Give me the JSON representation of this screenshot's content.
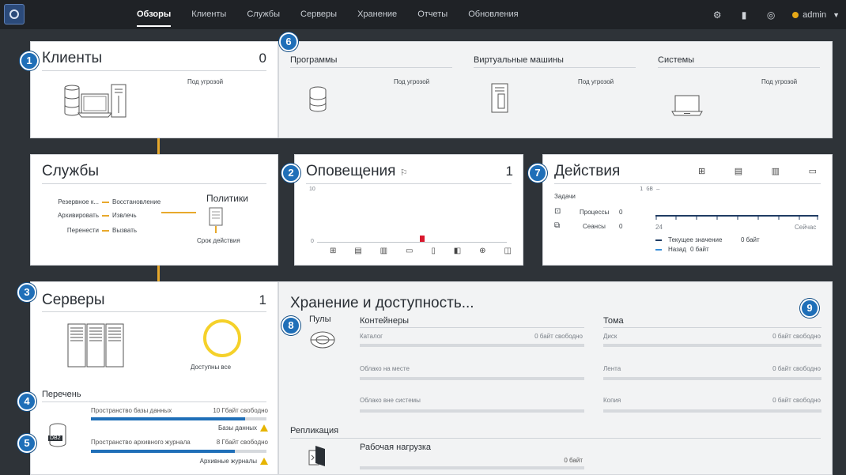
{
  "nav": {
    "tabs": [
      "Обзоры",
      "Клиенты",
      "Службы",
      "Серверы",
      "Хранение",
      "Отчеты",
      "Обновления"
    ],
    "active_tab": "Обзоры",
    "user": "admin"
  },
  "badges": [
    "1",
    "2",
    "3",
    "4",
    "5",
    "6",
    "7",
    "8",
    "9"
  ],
  "clients": {
    "title": "Клиенты",
    "count": "0",
    "status": "Под угрозой"
  },
  "programs": {
    "columns": [
      {
        "title": "Программы",
        "status": "Под угрозой"
      },
      {
        "title": "Виртуальные машины",
        "status": "Под угрозой"
      },
      {
        "title": "Системы",
        "status": "Под угрозой"
      }
    ]
  },
  "services": {
    "title": "Службы",
    "pairs": [
      {
        "left": "Резервное к...",
        "right": "Восстановление"
      },
      {
        "left": "Архивировать",
        "right": "Извлечь"
      },
      {
        "left": "Перенести",
        "right": "Вызвать"
      }
    ],
    "policies_title": "Политики",
    "policies_label": "Срок действия"
  },
  "alerts": {
    "title": "Оповещения",
    "count": "1",
    "y_top": "10",
    "y_bottom": "0"
  },
  "actions": {
    "title": "Действия",
    "tasks_label": "Задачи",
    "processes_label": "Процессы",
    "processes_value": "0",
    "sessions_label": "Сеансы",
    "sessions_value": "0",
    "axis_top": "1 GB –",
    "axis_left": "24",
    "axis_right": "Сейчас",
    "legend_current": "Текущее значение",
    "legend_current_value": "0 байт",
    "legend_back": "Назад",
    "legend_back_value": "0 байт"
  },
  "servers": {
    "title": "Серверы",
    "count": "1",
    "status": "Доступны все",
    "inventory_title": "Перечень",
    "db_label": "DB2",
    "rows": [
      {
        "label": "Пространство базы данных",
        "value": "10 Гбайт свободно",
        "fill": 0.88,
        "warn": "Базы данных"
      },
      {
        "label": "Пространство архивного журнала",
        "value": "8 Гбайт свободно",
        "fill": 0.82,
        "warn": "Архивные журналы"
      }
    ]
  },
  "storage": {
    "title": "Хранение и доступность...",
    "pools_label": "Пулы",
    "containers_title": "Контейнеры",
    "volumes_title": "Тома",
    "containers": [
      {
        "label": "Каталог",
        "value": "0 байт свободно"
      },
      {
        "label": "Облако на месте",
        "value": ""
      },
      {
        "label": "Облако вне системы",
        "value": ""
      }
    ],
    "volumes": [
      {
        "label": "Диск",
        "value": "0 байт свободно"
      },
      {
        "label": "Лента",
        "value": "0 байт свободно"
      },
      {
        "label": "Копия",
        "value": "0 байт свободно"
      }
    ],
    "replication_title": "Репликация",
    "workload_title": "Рабочая нагрузка",
    "workload_value": "0 байт"
  }
}
